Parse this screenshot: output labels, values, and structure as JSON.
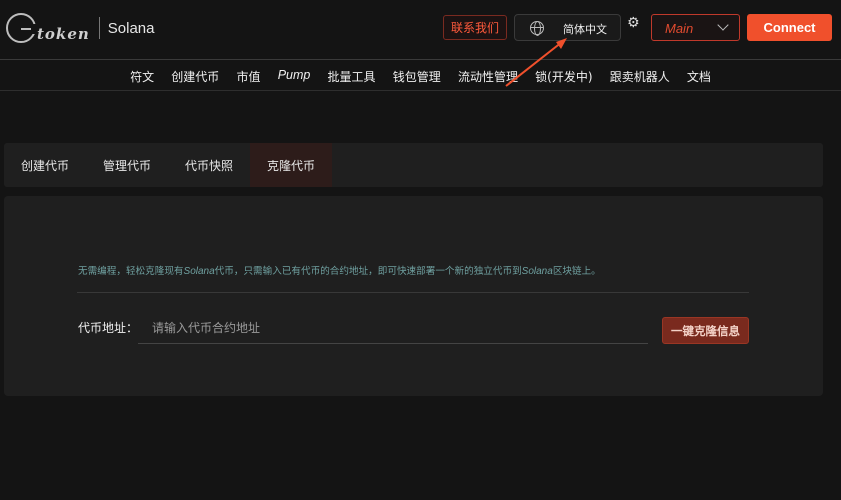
{
  "header": {
    "logo_word": "token",
    "chain_name": "Solana",
    "contact_label": "联系我们",
    "language_label": "简体中文",
    "network_label": "Main",
    "connect_label": "Connect"
  },
  "nav": {
    "items": [
      "符文",
      "创建代币",
      "市值",
      "Pump",
      "批量工具",
      "钱包管理",
      "流动性管理",
      "锁(开发中)",
      "跟卖机器人",
      "文档"
    ]
  },
  "tabs": {
    "items": [
      "创建代币",
      "管理代币",
      "代币快照",
      "克隆代币"
    ],
    "active_index": 3
  },
  "clone": {
    "description_parts": [
      "无需编程，轻松克隆现有",
      "Solana",
      "代币，只需输入已有代币的合约地址，即可快速部署一个新的独立代币到",
      "Solana",
      "区块链上。"
    ],
    "field_label": "代币地址：",
    "field_placeholder": "请输入代币合约地址",
    "field_value": "",
    "button_label": "一键克隆信息"
  },
  "colors": {
    "accent": "#f0502c",
    "contact_text": "#ff5a3c",
    "description_text": "#6fa0a0",
    "background": "#141414",
    "panel": "#1f1f1f"
  },
  "icons": [
    "globe-icon",
    "gear-icon",
    "chevron-down-icon",
    "arrow-annotation"
  ]
}
